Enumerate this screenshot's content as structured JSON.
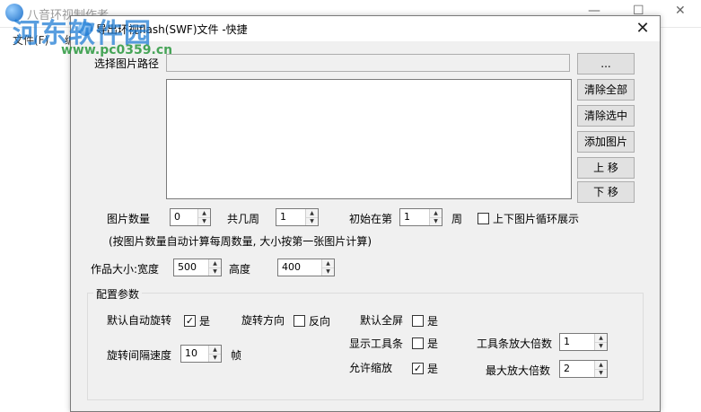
{
  "background": {
    "app_title": "八音环视制作者",
    "menu_file": "文件(F)",
    "menu_second": "编",
    "minimize": "—",
    "maximize": "☐",
    "close": "✕"
  },
  "watermark": {
    "logo": "河东软件园",
    "url": "www.pc0359.cn"
  },
  "dialog": {
    "title": "导出环视flash(SWF)文件 -快捷",
    "close": "✕",
    "path_label": "选择图片路径",
    "path_value": "",
    "browse_button": "...",
    "buttons": [
      "清除全部",
      "清除选中",
      "添加图片",
      "上 移",
      "下 移"
    ],
    "image_count": {
      "label": "图片数量",
      "value": "0"
    },
    "weeks": {
      "label": "共几周",
      "value": "1"
    },
    "start": {
      "label": "初始在第",
      "value": "1",
      "suffix": "周"
    },
    "loop": {
      "label": "上下图片循环展示",
      "checked": false
    },
    "hint": "(按图片数量自动计算每周数量, 大小按第一张图片计算)",
    "size": {
      "label": "作品大小:宽度",
      "width": "500",
      "height_label": "高度",
      "height": "400"
    },
    "config": {
      "title": "配置参数",
      "auto_rotate": {
        "label": "默认自动旋转",
        "option": "是",
        "checked": true
      },
      "direction": {
        "label": "旋转方向",
        "option": "反向",
        "checked": false
      },
      "fullscreen": {
        "label": "默认全屏",
        "option": "是",
        "checked": false
      },
      "toolbar": {
        "label": "显示工具条",
        "option": "是",
        "checked": false
      },
      "interval": {
        "label": "旋转间隔速度",
        "value": "10",
        "unit": "帧"
      },
      "zoom": {
        "label": "允许缩放",
        "option": "是",
        "checked": true
      },
      "toolbar_zoom": {
        "label": "工具条放大倍数",
        "value": "1"
      },
      "max_zoom": {
        "label": "最大放大倍数",
        "value": "2"
      }
    }
  }
}
